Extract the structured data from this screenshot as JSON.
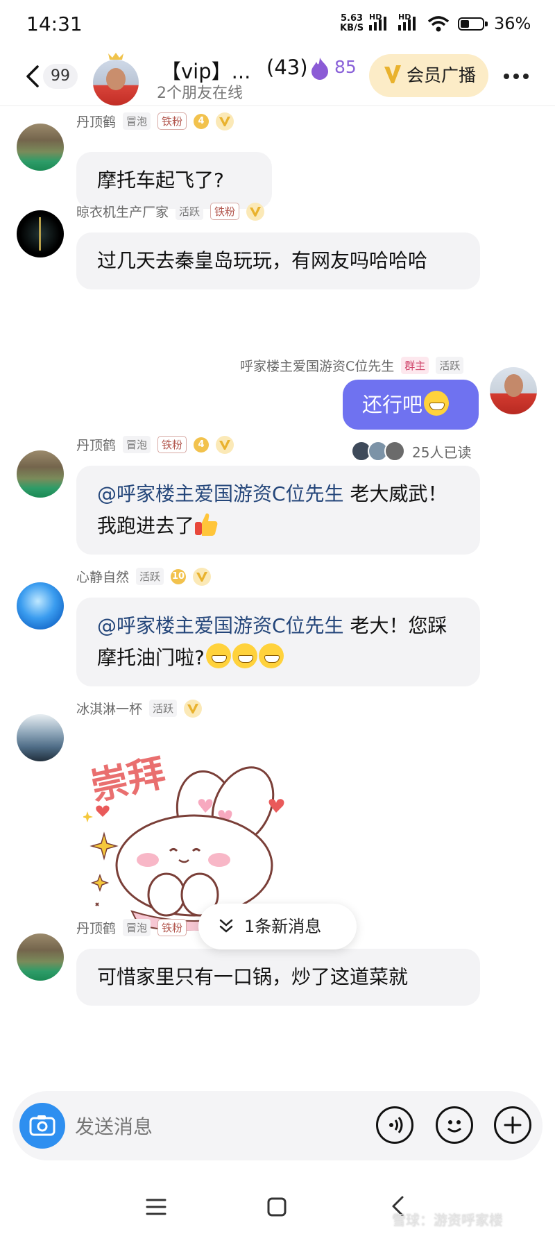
{
  "status_bar": {
    "time": "14:31",
    "net_speed_value": "5.63",
    "net_speed_unit": "KB/S",
    "hd1": "HD",
    "hd2": "HD",
    "battery": "36%"
  },
  "header": {
    "back_count": "99",
    "group_name": "【vip】...",
    "member_count": "(43)",
    "fire_count": "85",
    "online_text": "2个朋友在线",
    "vip_broadcast_label": "会员广播"
  },
  "messages": [
    {
      "sender": "丹顶鹤",
      "tags": [
        "冒泡",
        "铁粉"
      ],
      "level": "4",
      "text": "摩托车起飞了?"
    },
    {
      "sender": "晾衣机生产厂家",
      "tags": [
        "活跃",
        "铁粉"
      ],
      "text": "过几天去秦皇岛玩玩，有网友吗哈哈哈"
    },
    {
      "sender": "呼家楼主爱国游资C位先生",
      "tags": [
        "群主",
        "活跃"
      ],
      "text": "还行吧",
      "read_count": "25人已读"
    },
    {
      "sender": "丹顶鹤",
      "tags": [
        "冒泡",
        "铁粉"
      ],
      "level": "4",
      "mention": "@呼家楼主爱国游资C位先生",
      "text": " 老大威武！我跑进去了"
    },
    {
      "sender": "心静自然",
      "tags": [
        "活跃"
      ],
      "level": "10",
      "mention": "@呼家楼主爱国游资C位先生",
      "text": " 老大！您踩摩托油门啦?"
    },
    {
      "sender": "冰淇淋一杯",
      "tags": [
        "活跃"
      ],
      "sticker_text": "崇拜"
    },
    {
      "sender": "丹顶鹤",
      "tags": [
        "冒泡",
        "铁粉"
      ],
      "text": "可惜家里只有一口锅，炒了这道菜就"
    }
  ],
  "new_message_pill": "1条新消息",
  "input": {
    "placeholder": "发送消息"
  },
  "watermark": "雪球：游资呼家楼",
  "colors": {
    "my_bubble": "#6f72f0",
    "other_bubble": "#f3f3f5",
    "mention": "#24467a",
    "vip_button_bg": "#fcecc7",
    "camera": "#2e8ff0"
  }
}
